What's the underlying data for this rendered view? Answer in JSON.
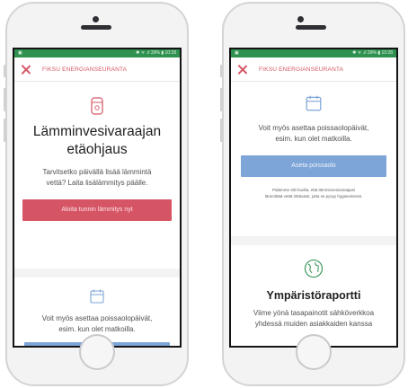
{
  "status_bar": {
    "left_icon": "photo-icon",
    "right_text": "✱ ᯤ .ıl 39% ▮ 10:28"
  },
  "left_screen": {
    "app_title": "FIKSU ENERGIANSEURANTA",
    "heating_card": {
      "icon": "water-heater-icon",
      "title_line1": "Lämminvesivaraajan",
      "title_line2": "etäohjaus",
      "text_line1": "Tarvitsetko päivällä lisää lämmintä",
      "text_line2": "vettä? Laita lisälämmitys päälle.",
      "button_label": "Aloita tunnin lämmitys nyt"
    },
    "absence_card": {
      "icon": "calendar-icon",
      "text_line1": "Voit myös asettaa poissaolopäivät,",
      "text_line2": "esim. kun olet matkoilla."
    }
  },
  "right_screen": {
    "app_title": "FIKSU ENERGIANSEURANTA",
    "absence_card": {
      "icon": "calendar-icon",
      "text_line1": "Voit myös asettaa poissaolopäivät,",
      "text_line2": "esim. kun olet matkoilla.",
      "button_label": "Aseta poissaolo",
      "note_line1": "Pidämme silti huolta, että lämminvesivaraajasi",
      "note_line2": "lämmittää vettä riittävästi, jotta se pysyy hygieenisenä."
    },
    "report_card": {
      "icon": "globe-icon",
      "title": "Ympäristöraportti",
      "text_line1": "Viime yönä tasapainotit sähköverkkoa",
      "text_line2": "yhdessä muiden asiakkaiden kanssa"
    }
  },
  "colors": {
    "accent_red": "#d65565",
    "accent_blue": "#7da5d8",
    "status_green": "#2e9150"
  }
}
